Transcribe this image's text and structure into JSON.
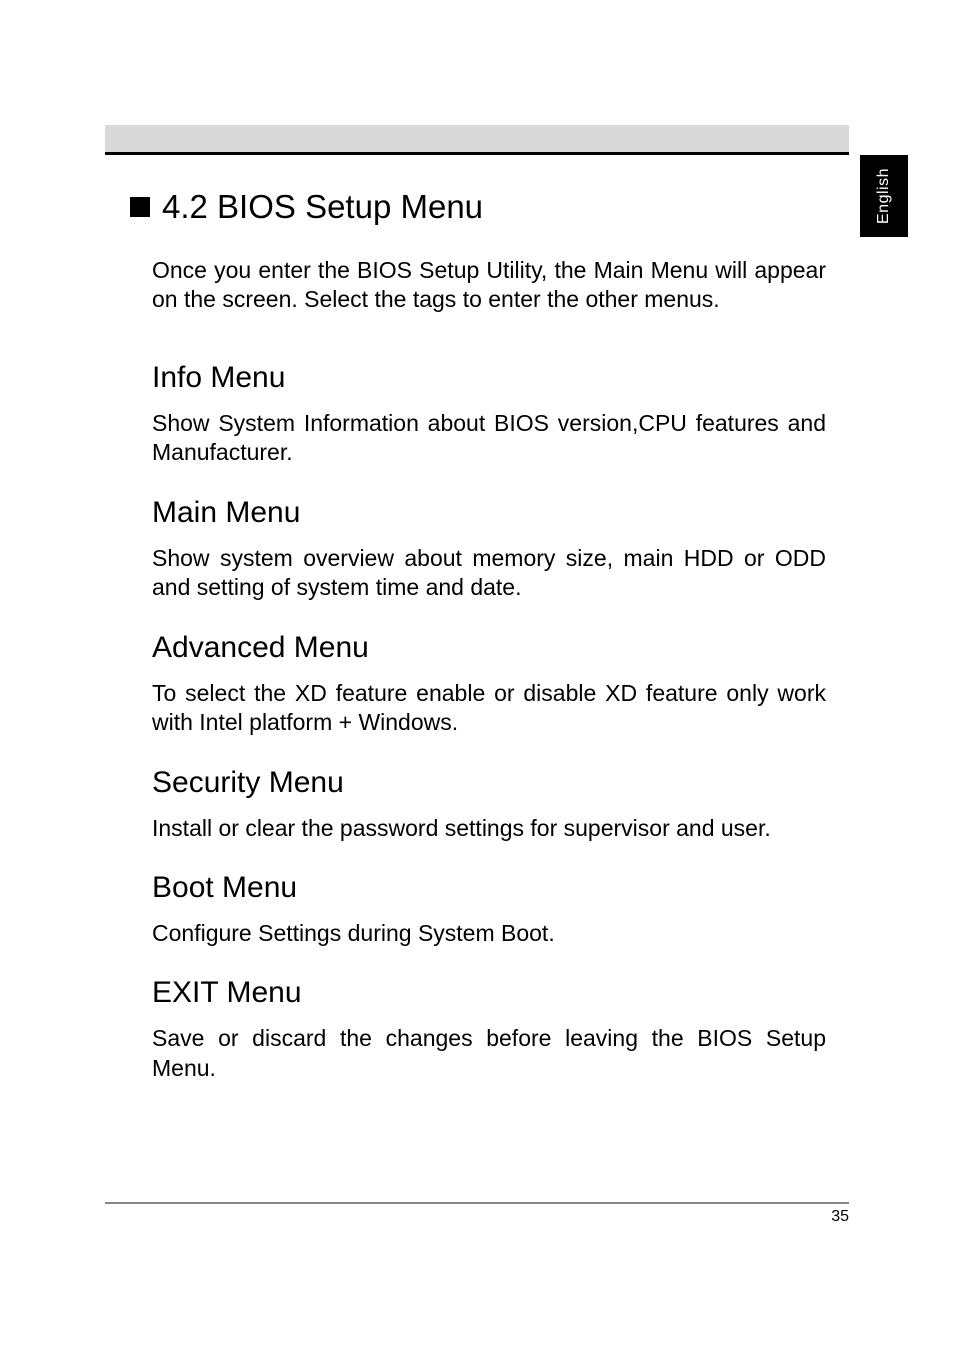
{
  "sideTab": "English",
  "mainHeading": "4.2 BIOS Setup Menu",
  "intro": "Once you enter the BIOS Setup Utility, the Main Menu will appear on the screen. Select the tags to enter the other menus.",
  "sections": [
    {
      "heading": "Info Menu",
      "body": "Show System Information about BIOS version,CPU features and Manufacturer."
    },
    {
      "heading": "Main Menu",
      "body": "Show system overview about memory size, main HDD or ODD and setting of system time and date."
    },
    {
      "heading": "Advanced Menu",
      "body": "To select the XD feature enable or disable XD feature only work with Intel platform + Windows."
    },
    {
      "heading": "Security Menu",
      "body": "Install or clear the password settings for supervisor and user."
    },
    {
      "heading": "Boot Menu",
      "body": "Configure Settings during System Boot."
    },
    {
      "heading": "EXIT Menu",
      "body": "Save or discard the changes before leaving the BIOS Setup Menu."
    }
  ],
  "pageNumber": "35"
}
